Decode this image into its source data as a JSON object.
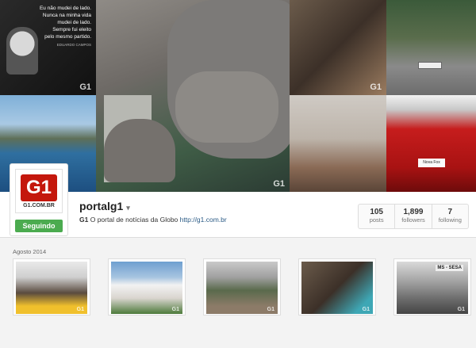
{
  "cover": {
    "quote_lines": [
      "Eu não mudei de lado.",
      "Nunca na minha vida",
      "mudei de lado.",
      "Sempre fui eleito",
      "pelo mesmo partido."
    ],
    "quote_author": "EDUARDO CAMPOS",
    "watermark": "G1",
    "car_plate": "",
    "red_car_plate": "Nova Fox"
  },
  "profile": {
    "logo_mark": "G1",
    "logo_caption": "G1.COM.BR",
    "follow_label": "Seguindo",
    "username": "portalg1",
    "caret": "▾",
    "bio_prefix": "G1",
    "bio_text": "O portal de notícias da Globo",
    "bio_link": "http://g1.com.br"
  },
  "stats": [
    {
      "num": "105",
      "label": "posts"
    },
    {
      "num": "1,899",
      "label": "followers"
    },
    {
      "num": "7",
      "label": "following"
    }
  ],
  "grid": {
    "month": "Agosto 2014",
    "watermark": "G1",
    "sign_text": "MS - SESA"
  }
}
